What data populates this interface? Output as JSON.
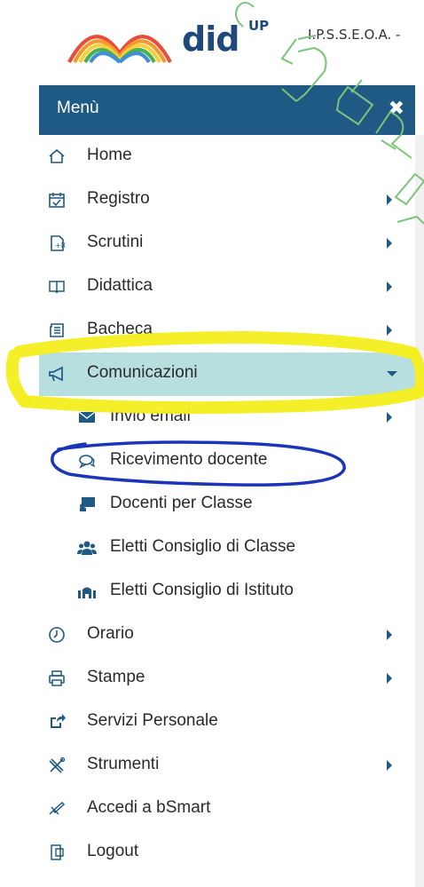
{
  "header": {
    "logo_main": "did",
    "logo_sup": "UP",
    "school": "I.P.S.S.E.O.A. -"
  },
  "menu": {
    "title": "Menù",
    "close_icon": "close-icon",
    "items": [
      {
        "label": "Home",
        "icon": "home-icon",
        "submenu": false
      },
      {
        "label": "Registro",
        "icon": "calendar-check-icon",
        "submenu": true
      },
      {
        "label": "Scrutini",
        "icon": "scrutini-icon",
        "submenu": true
      },
      {
        "label": "Didattica",
        "icon": "book-icon",
        "submenu": true
      },
      {
        "label": "Bacheca",
        "icon": "newspaper-icon",
        "submenu": true
      },
      {
        "label": "Comunicazioni",
        "icon": "megaphone-icon",
        "submenu": true,
        "expanded": true
      },
      {
        "label": "Invio email",
        "icon": "envelope-icon",
        "submenu": true,
        "child": true
      },
      {
        "label": "Ricevimento docente",
        "icon": "chat-icon",
        "submenu": false,
        "child": true
      },
      {
        "label": "Docenti per Classe",
        "icon": "teacher-board-icon",
        "submenu": false,
        "child": true
      },
      {
        "label": "Eletti Consiglio di Classe",
        "icon": "users-icon",
        "submenu": false,
        "child": true
      },
      {
        "label": "Eletti Consiglio di Istituto",
        "icon": "institute-icon",
        "submenu": false,
        "child": true
      },
      {
        "label": "Orario",
        "icon": "clock-icon",
        "submenu": true
      },
      {
        "label": "Stampe",
        "icon": "printer-icon",
        "submenu": true
      },
      {
        "label": "Servizi Personale",
        "icon": "share-icon",
        "submenu": false
      },
      {
        "label": "Strumenti",
        "icon": "tools-icon",
        "submenu": true
      },
      {
        "label": "Accedi a bSmart",
        "icon": "bsmart-icon",
        "submenu": false
      },
      {
        "label": "Logout",
        "icon": "logout-icon",
        "submenu": false
      }
    ]
  },
  "colors": {
    "menu_header_bg": "#1f5a84",
    "active_item_bg": "#b7dfe0",
    "highlight_yellow": "#f4ee1e",
    "annotation_blue": "#1a35b8",
    "watermark_green": "#7cc47a"
  },
  "watermark": "CARTA"
}
